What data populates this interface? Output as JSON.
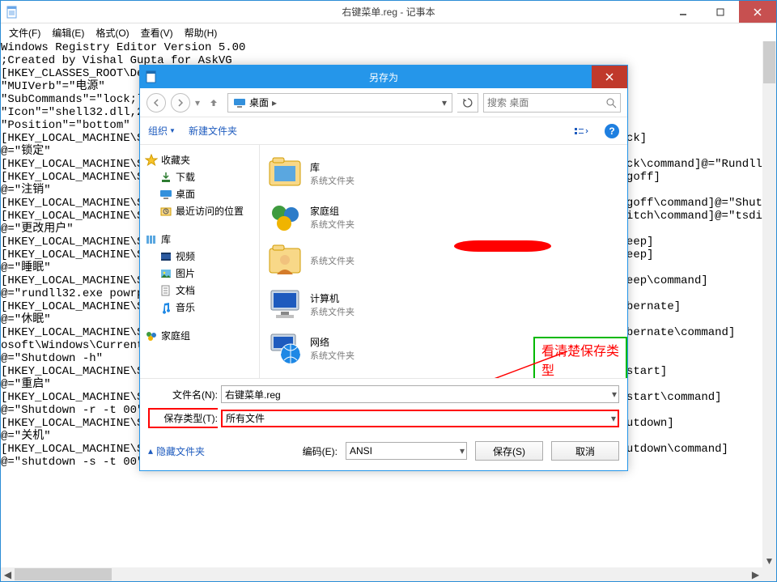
{
  "notepad": {
    "title": "右键菜单.reg - 记事本",
    "menu": {
      "file": "文件(F)",
      "edit": "编辑(E)",
      "format": "格式(O)",
      "view": "查看(V)",
      "help": "帮助(H)"
    },
    "text": "Windows Registry Editor Version 5.00\n;Created by Vishal Gupta for AskVG\n[HKEY_CLASSES_ROOT\\DesktopBackground\\Shell\\Power Menu]\n\"MUIVerb\"=\"电源\"\n\"SubCommands\"=\"lock;logoff;switch;sleep;hibernate;restart;safemode;shutdown;hybridshutdown\"\n\"Icon\"=\"shell32.dll,215\"\n\"Position\"=\"bottom\"\n[HKEY_LOCAL_MACHINE\\SOFTWARE\\Microsoft\\Windows\\CurrentVersion\\Explorer\\CommandStore\\shell\\lock]\n@=\"锁定\"\n[HKEY_LOCAL_MACHINE\\SOFTWARE\\Microsoft\\Windows\\CurrentVersion\\Explorer\\CommandStore\\shell\\lock\\command]@=\"Rundll32 User32.dll,LockWorkStation\"\n[HKEY_LOCAL_MACHINE\\SOFTWARE\\Microsoft\\Windows\\CurrentVersion\\Explorer\\CommandStore\\shell\\logoff]\n@=\"注销\"\n[HKEY_LOCAL_MACHINE\\SOFTWARE\\Microsoft\\Windows\\CurrentVersion\\Explorer\\CommandStore\\shell\\logoff\\command]@=\"Shutdown -l\"\n[HKEY_LOCAL_MACHINE\\SOFTWARE\\Microsoft\\Windows\\CurrentVersion\\Explorer\\CommandStore\\shell\\switch\\command]@=\"tsdiscon\"\n@=\"更改用户\"\n[HKEY_LOCAL_MACHINE\\SOFTWARE\\Microsoft\\Windows\\CurrentVersion\\Explorer\\CommandStore\\shell\\sleep]\n[HKEY_LOCAL_MACHINE\\SOFTWARE\\Microsoft\\Windows\\CurrentVersion\\Explorer\\CommandStore\\shell\\sleep]\n@=\"睡眠\"\n[HKEY_LOCAL_MACHINE\\SOFTWARE\\Microsoft\\Windows\\CurrentVersion\\Explorer\\CommandStore\\shell\\sleep\\command]\n@=\"rundll32.exe powrprof.dll,SetSuspendState Sleep\"\n[HKEY_LOCAL_MACHINE\\SOFTWARE\\Microsoft\\Windows\\CurrentVersion\\Explorer\\CommandStore\\shell\\hibernate]\n@=\"休眠\"\n[HKEY_LOCAL_MACHINE\\SOFTWARE\\Microsoft\\Windows\\CurrentVersion\\Explorer\\CommandStore\\shell\\hibernate\\command]\nosoft\\Windows\\CurrentVersion\\Explorer\\CommandStore\\shell\\hibernate\\command]\n@=\"Shutdown -h\"\n[HKEY_LOCAL_MACHINE\\SOFTWARE\\Microsoft\\Windows\\CurrentVersion\\Explorer\\CommandStore\\shell\\restart]\n@=\"重启\"\n[HKEY_LOCAL_MACHINE\\SOFTWARE\\Microsoft\\Windows\\CurrentVersion\\Explorer\\CommandStore\\shell\\restart\\command]\n@=\"Shutdown -r -t 00\"\n[HKEY_LOCAL_MACHINE\\SOFTWARE\\Microsoft\\Windows\\CurrentVersion\\Explorer\\CommandStore\\shell\\shutdown]\n@=\"关机\"\n[HKEY_LOCAL_MACHINE\\SOFTWARE\\Microsoft\\Windows\\CurrentVersion\\Explorer\\CommandStore\\shell\\shutdown\\command]\n@=\"shutdown -s -t 00\""
  },
  "saveas": {
    "title": "另存为",
    "breadcrumb": {
      "desktop": "桌面"
    },
    "search_placeholder": "搜索 桌面",
    "toolbar": {
      "organize": "组织",
      "newfolder": "新建文件夹"
    },
    "side": {
      "favorites": "收藏夹",
      "downloads": "下载",
      "desktop": "桌面",
      "recent": "最近访问的位置",
      "libraries": "库",
      "videos": "视频",
      "pictures": "图片",
      "documents": "文档",
      "music": "音乐",
      "homegroup": "家庭组"
    },
    "content": {
      "libraries": {
        "name": "库",
        "sub": "系统文件夹"
      },
      "homegroup": {
        "name": "家庭组",
        "sub": "系统文件夹"
      },
      "user": {
        "name": "",
        "sub": "系统文件夹"
      },
      "computer": {
        "name": "计算机",
        "sub": "系统文件夹"
      },
      "network": {
        "name": "网络",
        "sub": "系统文件夹"
      }
    },
    "fields": {
      "filename_label": "文件名(N):",
      "filename_value": "右键菜单.reg",
      "savetype_label": "保存类型(T):",
      "savetype_value": "所有文件"
    },
    "footer": {
      "hide": "隐藏文件夹",
      "encoding_label": "编码(E):",
      "encoding_value": "ANSI",
      "save": "保存(S)",
      "cancel": "取消"
    },
    "annotation": "看清楚保存类型"
  }
}
